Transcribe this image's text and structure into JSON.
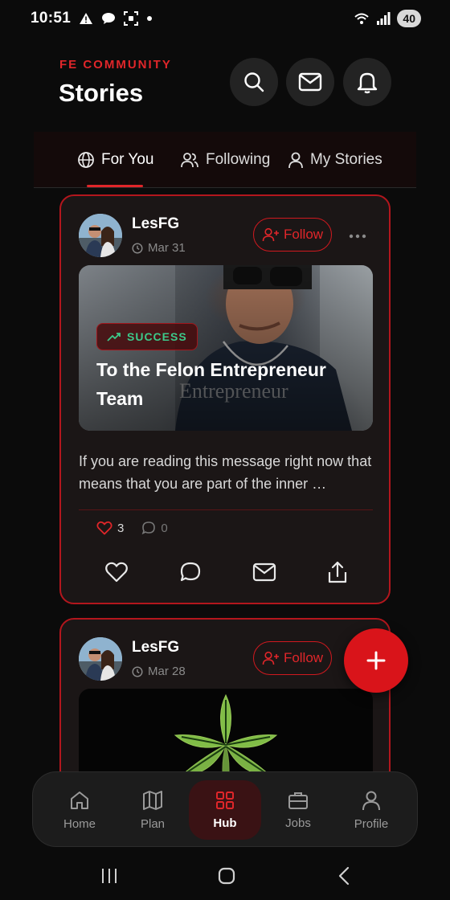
{
  "status_bar": {
    "time": "10:51",
    "battery": "40"
  },
  "header": {
    "brand": "FE COMMUNITY",
    "title": "Stories"
  },
  "tabs": [
    {
      "label": "For You",
      "icon": "globe-icon",
      "active": true
    },
    {
      "label": "Following",
      "icon": "users-icon",
      "active": false
    },
    {
      "label": "My Stories",
      "icon": "user-icon",
      "active": false
    }
  ],
  "posts": [
    {
      "author": "LesFG",
      "date": "Mar 31",
      "follow_label": "Follow",
      "badge": "SUCCESS",
      "media_title": "To the Felon Entrepreneur Team",
      "excerpt": "If you are reading this message right now that means that you are part of the inner …",
      "likes": "3",
      "comments": "0"
    },
    {
      "author": "LesFG",
      "date": "Mar 28",
      "follow_label": "Follow"
    }
  ],
  "bottom_nav": [
    {
      "label": "Home",
      "icon": "home-icon"
    },
    {
      "label": "Plan",
      "icon": "map-icon"
    },
    {
      "label": "Hub",
      "icon": "grid-icon",
      "active": true
    },
    {
      "label": "Jobs",
      "icon": "briefcase-icon"
    },
    {
      "label": "Profile",
      "icon": "profile-icon"
    }
  ],
  "colors": {
    "accent": "#e0262a",
    "background": "#0b0b0b",
    "card": "#1b1616",
    "success": "#3cc98a"
  }
}
